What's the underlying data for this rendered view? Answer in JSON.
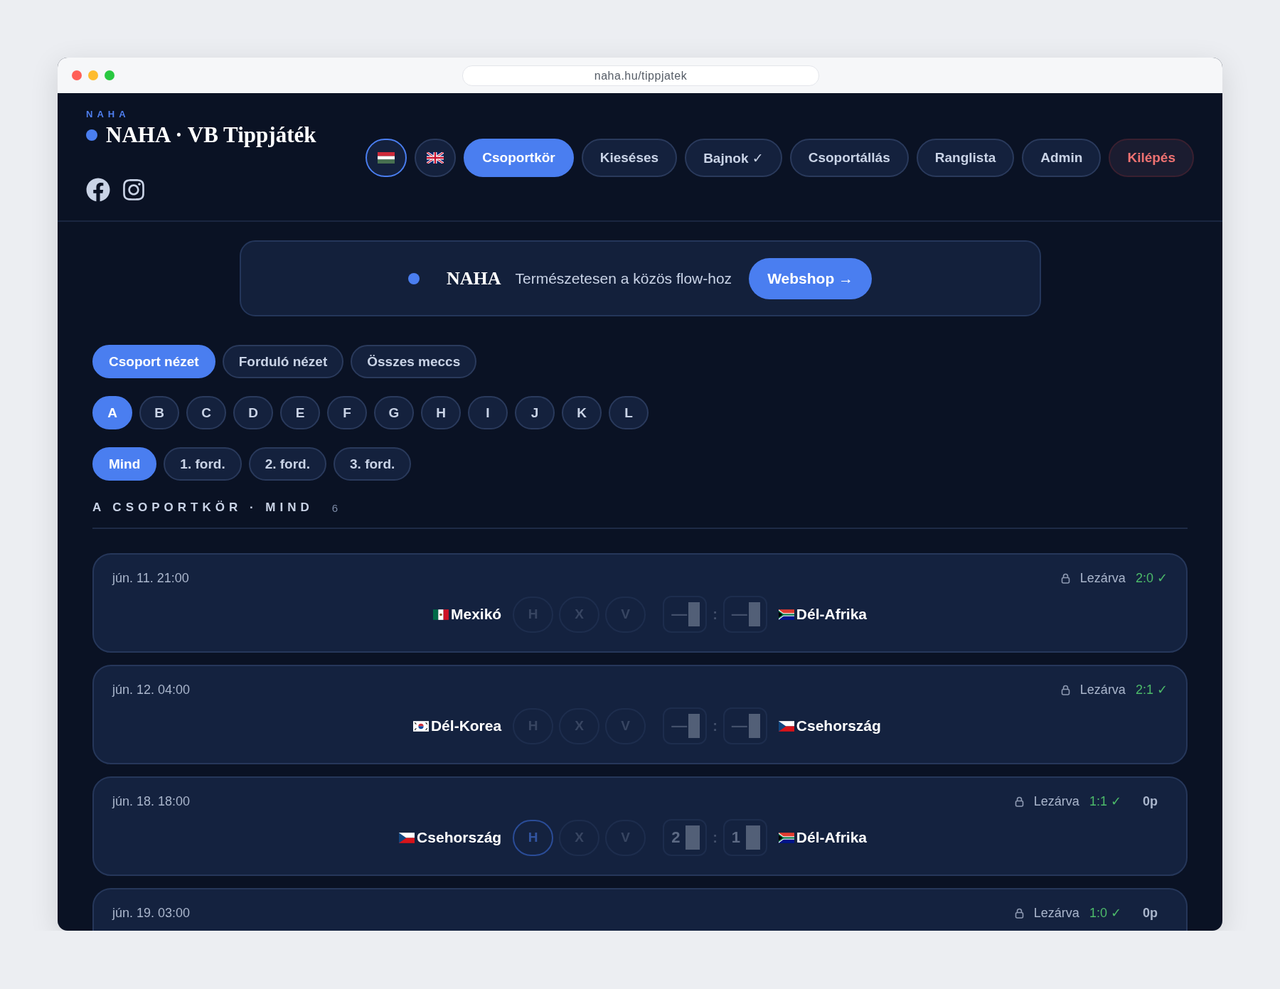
{
  "browser": {
    "url": "naha.hu/tippjatek"
  },
  "header": {
    "kicker": "NAHA",
    "title": "NAHA · VB Tippjáték",
    "social": [
      {
        "kind": "facebook"
      },
      {
        "kind": "instagram"
      }
    ],
    "nav": [
      {
        "kind": "hu",
        "selected": true
      },
      {
        "kind": "gb",
        "selected": false
      },
      {
        "kind": "link",
        "label": "Csoportkör",
        "selected": true
      },
      {
        "kind": "link",
        "label": "Kieséses",
        "selected": false
      },
      {
        "kind": "link",
        "label": "Bajnok ✓",
        "selected": false
      },
      {
        "kind": "link",
        "label": "Csoportállás",
        "selected": false
      },
      {
        "kind": "link",
        "label": "Ranglista",
        "selected": false
      },
      {
        "kind": "link",
        "label": "Admin",
        "selected": false
      },
      {
        "kind": "danger",
        "label": "Kilépés",
        "selected": false
      }
    ]
  },
  "banner": {
    "brand": "NAHA",
    "text": "Természetesen a közös flow-hoz",
    "button": "Webshop →"
  },
  "view_tabs": [
    {
      "label": "Csoport nézet",
      "selected": true
    },
    {
      "label": "Forduló nézet",
      "selected": false
    },
    {
      "label": "Összes meccs",
      "selected": false
    }
  ],
  "groups": [
    {
      "label": "A",
      "selected": true
    },
    {
      "label": "B",
      "selected": false
    },
    {
      "label": "C",
      "selected": false
    },
    {
      "label": "D",
      "selected": false
    },
    {
      "label": "E",
      "selected": false
    },
    {
      "label": "F",
      "selected": false
    },
    {
      "label": "G",
      "selected": false
    },
    {
      "label": "H",
      "selected": false
    },
    {
      "label": "I",
      "selected": false
    },
    {
      "label": "J",
      "selected": false
    },
    {
      "label": "K",
      "selected": false
    },
    {
      "label": "L",
      "selected": false
    }
  ],
  "rounds": [
    {
      "label": "Mind",
      "selected": true
    },
    {
      "label": "1. ford.",
      "selected": false
    },
    {
      "label": "2. ford.",
      "selected": false
    },
    {
      "label": "3. ford.",
      "selected": false
    }
  ],
  "section": {
    "title": "A CSOPORTKÖR · MIND",
    "count": "6"
  },
  "matches": [
    {
      "date": "jún. 11. 21:00",
      "status": "Lezárva",
      "locked": true,
      "result": "2:0 ✓",
      "home": {
        "name": "Mexikó",
        "kind": "mx"
      },
      "away": {
        "name": "Dél-Afrika",
        "kind": "za"
      },
      "picks": [
        {
          "label": "H",
          "selected": false
        },
        {
          "label": "X",
          "selected": false
        },
        {
          "label": "V",
          "selected": false
        }
      ],
      "home_score": {
        "placeholder": "—"
      },
      "away_score": {
        "placeholder": "—"
      },
      "separator": ":"
    },
    {
      "date": "jún. 12. 04:00",
      "status": "Lezárva",
      "locked": true,
      "result": "2:1 ✓",
      "home": {
        "name": "Dél-Korea",
        "kind": "kr"
      },
      "away": {
        "name": "Csehország",
        "kind": "cz"
      },
      "picks": [
        {
          "label": "H",
          "selected": false
        },
        {
          "label": "X",
          "selected": false
        },
        {
          "label": "V",
          "selected": false
        }
      ],
      "home_score": {
        "placeholder": "—"
      },
      "away_score": {
        "placeholder": "—"
      },
      "separator": ":"
    },
    {
      "date": "jún. 18. 18:00",
      "status": "Lezárva",
      "locked": true,
      "result": "1:1 ✓",
      "points": "0p",
      "home": {
        "name": "Csehország",
        "kind": "cz"
      },
      "away": {
        "name": "Dél-Afrika",
        "kind": "za"
      },
      "picks": [
        {
          "label": "H",
          "selected": true
        },
        {
          "label": "X",
          "selected": false
        },
        {
          "label": "V",
          "selected": false
        }
      ],
      "home_score": {
        "value": "2"
      },
      "away_score": {
        "value": "1"
      },
      "separator": ":"
    },
    {
      "date": "jún. 19. 03:00",
      "status": "Lezárva",
      "locked": true,
      "result": "1:0 ✓",
      "points": "0p"
    }
  ]
}
